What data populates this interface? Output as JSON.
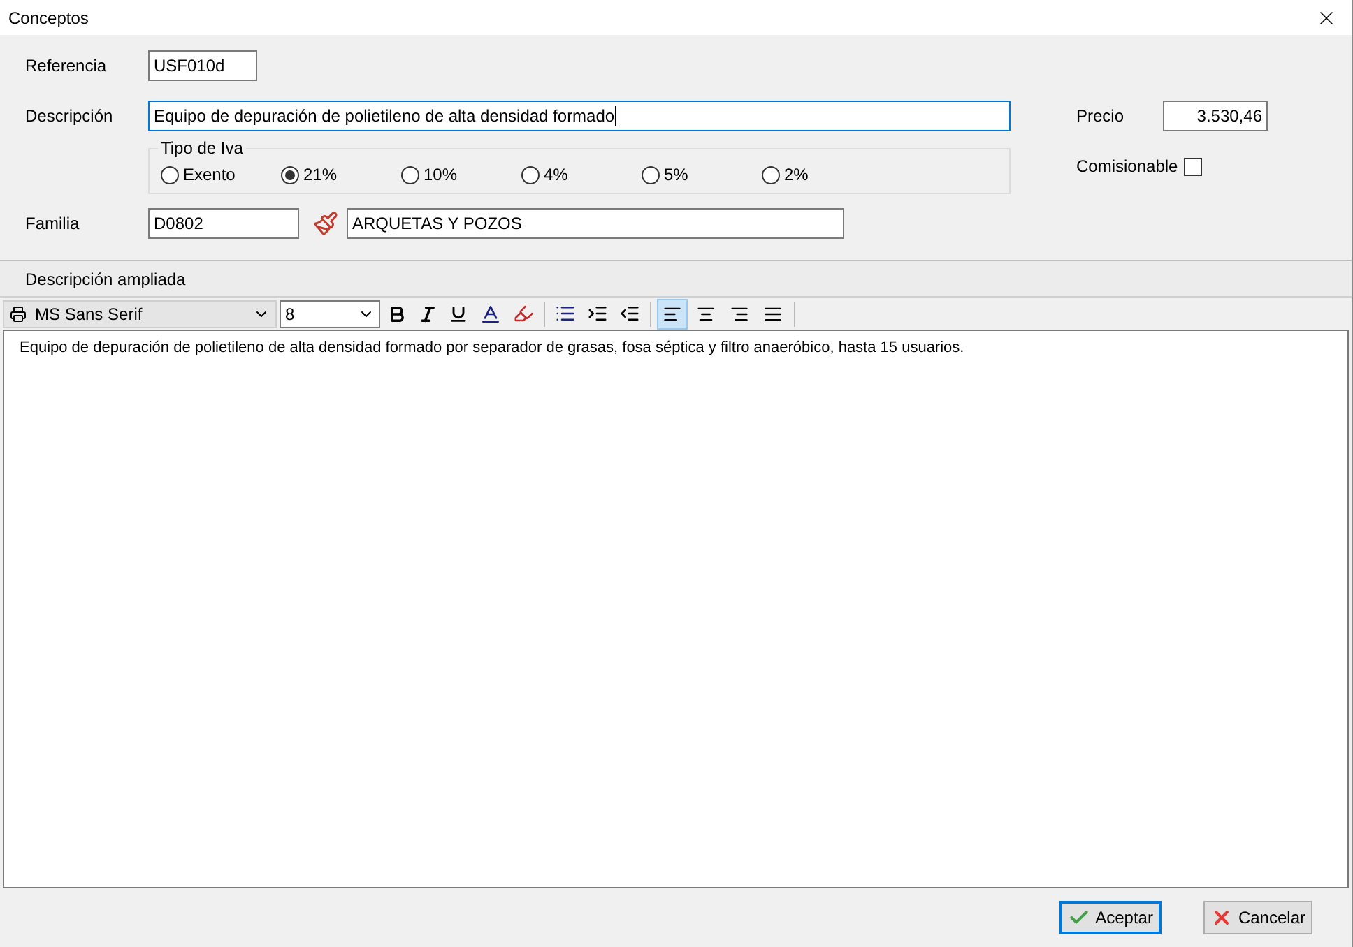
{
  "window": {
    "title": "Conceptos"
  },
  "form": {
    "referencia": {
      "label": "Referencia",
      "value": "USF010d"
    },
    "descripcion": {
      "label": "Descripción",
      "value": "Equipo de depuración de polietileno de alta densidad formado"
    },
    "precio": {
      "label": "Precio",
      "value": "3.530,46"
    },
    "tipo_iva": {
      "label": "Tipo de Iva",
      "options": [
        {
          "label": "Exento",
          "selected": false
        },
        {
          "label": "21%",
          "selected": true
        },
        {
          "label": "10%",
          "selected": false
        },
        {
          "label": "4%",
          "selected": false
        },
        {
          "label": "5%",
          "selected": false
        },
        {
          "label": "2%",
          "selected": false
        }
      ]
    },
    "comisionable": {
      "label": "Comisionable",
      "checked": false
    },
    "familia": {
      "label": "Familia",
      "code": "D0802",
      "name": "ARQUETAS Y POZOS"
    }
  },
  "extended": {
    "label": "Descripción ampliada",
    "toolbar": {
      "font": "MS Sans Serif",
      "size": "8",
      "align": [
        {
          "kind": "left",
          "selected": true
        },
        {
          "kind": "center",
          "selected": false
        },
        {
          "kind": "right",
          "selected": false
        },
        {
          "kind": "justify",
          "selected": false
        }
      ]
    },
    "text": "Equipo de depuración de polietileno de alta densidad formado por separador de grasas, fosa séptica y filtro anaeróbico, hasta 15 usuarios."
  },
  "buttons": [
    {
      "kind": "ok",
      "label": "Aceptar",
      "focused": true
    },
    {
      "kind": "cancel",
      "label": "Cancelar",
      "focused": false
    }
  ]
}
